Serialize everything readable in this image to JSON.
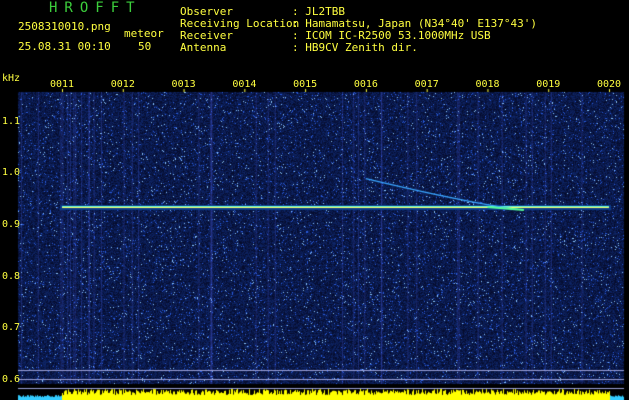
{
  "header": {
    "brand": "HROFFT",
    "filename": "2508310010.png",
    "mode": "meteor",
    "datetime": "25.08.31 00:10",
    "count": "50",
    "info": [
      {
        "label": "Observer",
        "value": ": JL2TBB"
      },
      {
        "label": "Receiving Location",
        "value": ": Hamamatsu, Japan (N34°40' E137°43')"
      },
      {
        "label": "Receiver",
        "value": ": ICOM IC-R2500 53.1000MHz USB"
      },
      {
        "label": "Antenna",
        "value": ": HB9CV Zenith dir."
      }
    ]
  },
  "chart_data": {
    "type": "heatmap",
    "xlabel": "",
    "ylabel": "kHz",
    "x_ticks": [
      "0011",
      "0012",
      "0013",
      "0014",
      "0015",
      "0016",
      "0017",
      "0018",
      "0019",
      "0020"
    ],
    "y_ticks": [
      "1.1",
      "1.0",
      "0.9",
      "0.8",
      "0.7",
      "0.6"
    ],
    "ylim": [
      0.6,
      1.15
    ],
    "carrier": {
      "freq_khz": 0.935,
      "start": "0011",
      "end": "0020"
    },
    "meteor_trace": {
      "start_time": "0016",
      "start_freq_khz": 0.99,
      "end_time": "0018.5",
      "end_freq_khz": 0.93
    },
    "colors": {
      "background": "#000033",
      "noise": "#2a3cff",
      "carrier": "#ffff66",
      "text": "#ffff40",
      "brand": "#3ccf3c",
      "amplitude": "#ffff00"
    }
  }
}
